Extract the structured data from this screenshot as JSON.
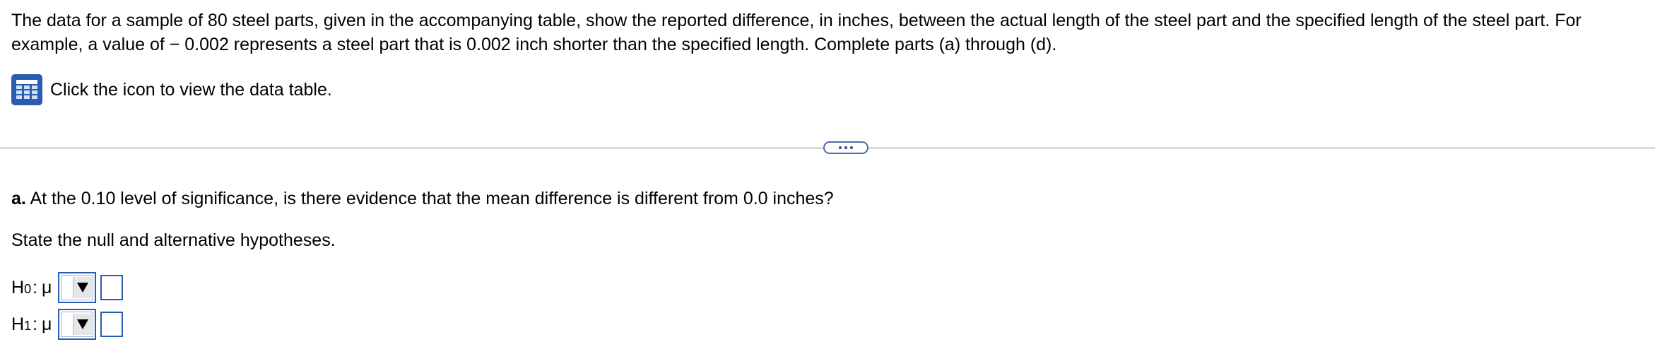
{
  "question": {
    "text": "The data for a sample of 80 steel parts, given in the accompanying table, show the reported difference, in inches, between the actual length of the steel part and the specified length of the steel part. For example, a value of − 0.002 represents a steel part that is 0.002 inch shorter than the specified length. Complete parts (a) through (d)."
  },
  "data_table": {
    "icon": "table-grid-icon",
    "link_text": "Click the icon to view the data table."
  },
  "divider": {
    "more_icon": "ellipsis-icon"
  },
  "part_a": {
    "letter": "a.",
    "text": "At the 0.10 level of significance, is there evidence that the mean difference is different from 0.0 inches?"
  },
  "instruction": "State the null and alternative hypotheses.",
  "hypotheses": [
    {
      "letter": "H",
      "subscript": "0",
      "colon": ":",
      "parameter": "μ",
      "selected_operator": "",
      "value": ""
    },
    {
      "letter": "H",
      "subscript": "1",
      "colon": ":",
      "parameter": "μ",
      "selected_operator": "",
      "value": ""
    }
  ],
  "colors": {
    "accent": "#2a5db0",
    "divider": "#8a8a8a"
  }
}
